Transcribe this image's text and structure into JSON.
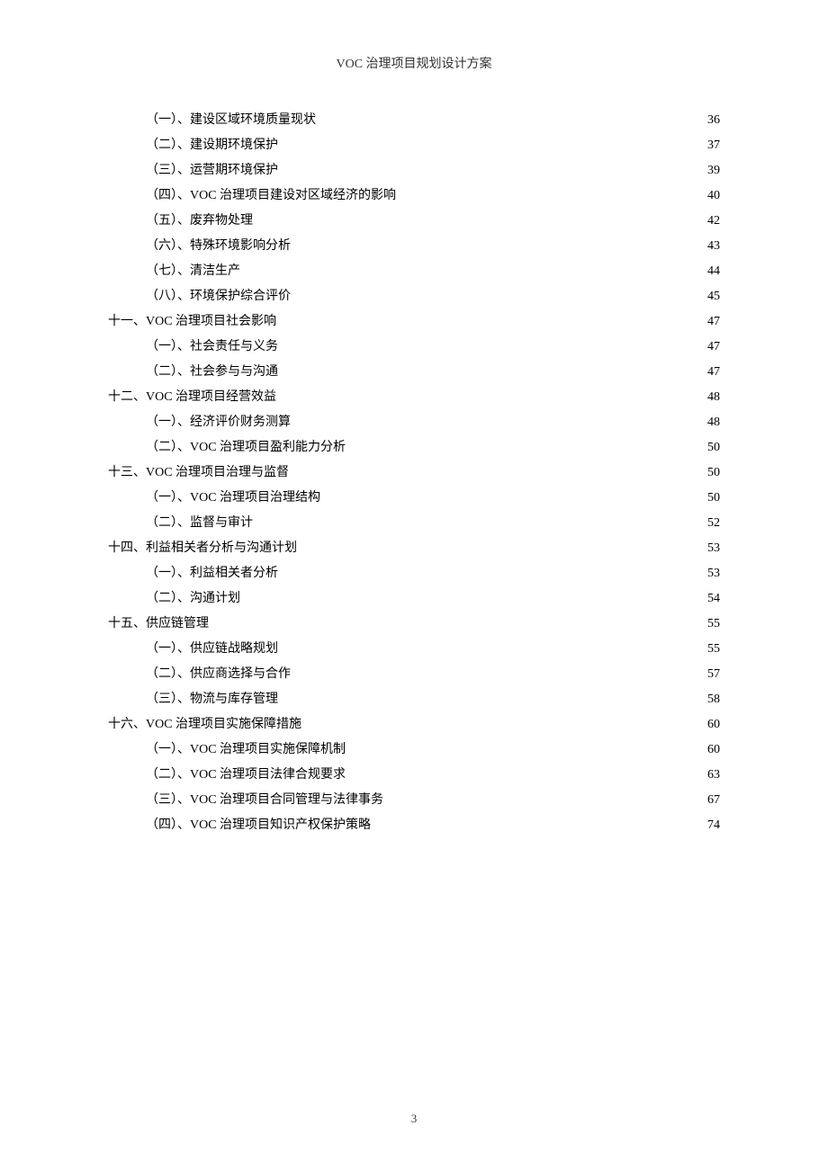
{
  "header": {
    "title": "VOC 治理项目规划设计方案"
  },
  "toc": [
    {
      "level": 2,
      "label": "（一）、建设区域环境质量现状",
      "page": "36"
    },
    {
      "level": 2,
      "label": "（二）、建设期环境保护",
      "page": "37"
    },
    {
      "level": 2,
      "label": "（三）、运营期环境保护",
      "page": "39"
    },
    {
      "level": 2,
      "label": "（四）、VOC 治理项目建设对区域经济的影响",
      "page": "40"
    },
    {
      "level": 2,
      "label": "（五）、废弃物处理",
      "page": "42"
    },
    {
      "level": 2,
      "label": "（六）、特殊环境影响分析",
      "page": "43"
    },
    {
      "level": 2,
      "label": "（七）、清洁生产",
      "page": "44"
    },
    {
      "level": 2,
      "label": "（八）、环境保护综合评价",
      "page": "45"
    },
    {
      "level": 1,
      "label": "十一、VOC 治理项目社会影响",
      "page": "47"
    },
    {
      "level": 2,
      "label": "（一）、社会责任与义务",
      "page": "47"
    },
    {
      "level": 2,
      "label": "（二）、社会参与与沟通",
      "page": "47"
    },
    {
      "level": 1,
      "label": "十二、VOC 治理项目经营效益",
      "page": "48"
    },
    {
      "level": 2,
      "label": "（一）、经济评价财务测算",
      "page": "48"
    },
    {
      "level": 2,
      "label": "（二）、VOC 治理项目盈利能力分析",
      "page": "50"
    },
    {
      "level": 1,
      "label": "十三、VOC 治理项目治理与监督",
      "page": "50"
    },
    {
      "level": 2,
      "label": "（一）、VOC 治理项目治理结构",
      "page": "50"
    },
    {
      "level": 2,
      "label": "（二）、监督与审计",
      "page": "52"
    },
    {
      "level": 1,
      "label": "十四、利益相关者分析与沟通计划",
      "page": "53"
    },
    {
      "level": 2,
      "label": "（一）、利益相关者分析",
      "page": "53"
    },
    {
      "level": 2,
      "label": "（二）、沟通计划",
      "page": "54"
    },
    {
      "level": 1,
      "label": "十五、供应链管理",
      "page": "55"
    },
    {
      "level": 2,
      "label": "（一）、供应链战略规划",
      "page": "55"
    },
    {
      "level": 2,
      "label": "（二）、供应商选择与合作",
      "page": "57"
    },
    {
      "level": 2,
      "label": "（三）、物流与库存管理",
      "page": "58"
    },
    {
      "level": 1,
      "label": "十六、VOC 治理项目实施保障措施",
      "page": "60"
    },
    {
      "level": 2,
      "label": "（一）、VOC 治理项目实施保障机制",
      "page": "60"
    },
    {
      "level": 2,
      "label": "（二）、VOC 治理项目法律合规要求",
      "page": "63"
    },
    {
      "level": 2,
      "label": "（三）、VOC 治理项目合同管理与法律事务",
      "page": "67"
    },
    {
      "level": 2,
      "label": "（四）、VOC 治理项目知识产权保护策略",
      "page": "74"
    }
  ],
  "footer": {
    "page_number": "3"
  }
}
